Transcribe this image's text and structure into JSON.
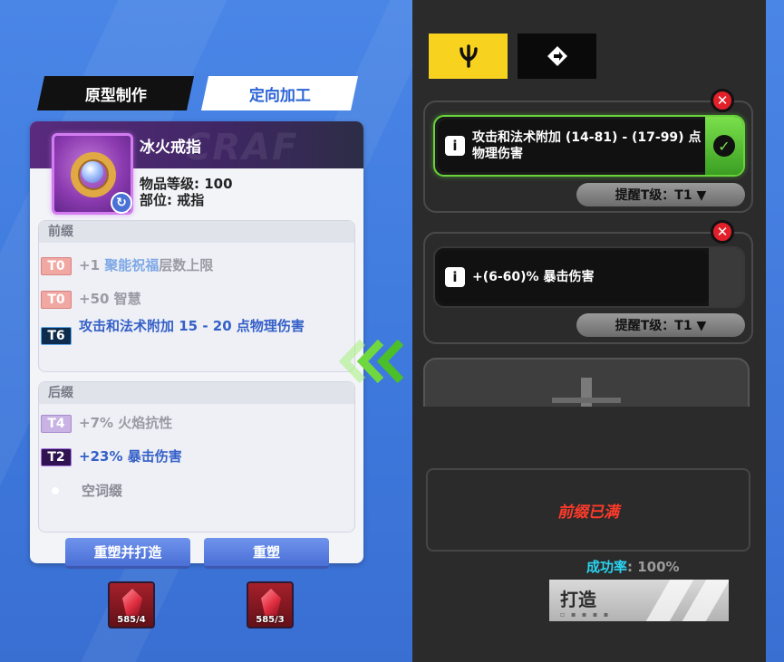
{
  "tabs": {
    "prototype": "原型制作",
    "directed": "定向加工"
  },
  "item": {
    "name": "冰火戒指",
    "level": "物品等级: 100",
    "slot": "部位: 戒指",
    "watermark": "CRAF",
    "rarity_color": "#8c3bb0"
  },
  "prefix": {
    "title": "前缀",
    "affixes": [
      {
        "tier": "T0",
        "pre": "+1 ",
        "highlight": "聚能祝福",
        "post": "层数上限"
      },
      {
        "tier": "T0",
        "text": "+50 智慧"
      },
      {
        "tier": "T6",
        "text": "攻击和法术附加 15 - 20 点物理伤害"
      }
    ]
  },
  "suffix": {
    "title": "后缀",
    "affixes": [
      {
        "tier": "T4",
        "text": "+7% 火焰抗性"
      },
      {
        "tier": "T2",
        "text": "+23% 暴击伤害"
      },
      {
        "text": "空词缀"
      }
    ]
  },
  "buttons": {
    "reshape_forge": "重塑并打造",
    "reshape": "重塑"
  },
  "materials": [
    {
      "count": "585/4"
    },
    {
      "count": "585/3"
    }
  ],
  "right": {
    "target_mods": [
      {
        "text": "攻击和法术附加 (14-81) - (17-99) 点物理伤害",
        "remind": "提醒T级：T1 ▼",
        "active": true
      },
      {
        "text": "+(6-60)% 暴击伤害",
        "remind": "提醒T级：T1 ▼",
        "active": false
      }
    ],
    "status": "前缀已满",
    "success_rate_label": "成功率",
    "success_rate_value": ": 100%",
    "forge_button": "打造"
  },
  "colors": {
    "accent_yellow": "#f7d21e",
    "active_green": "#67d43a",
    "error_red": "#ff3a2a",
    "rate_cyan": "#2bd3f0"
  },
  "icons": {
    "tab_a": "trident-icon",
    "tab_b": "diamond-arrow-icon",
    "info": "info-icon",
    "check": "check-icon",
    "close": "close-icon",
    "chevron": "chevron-left-icon"
  }
}
